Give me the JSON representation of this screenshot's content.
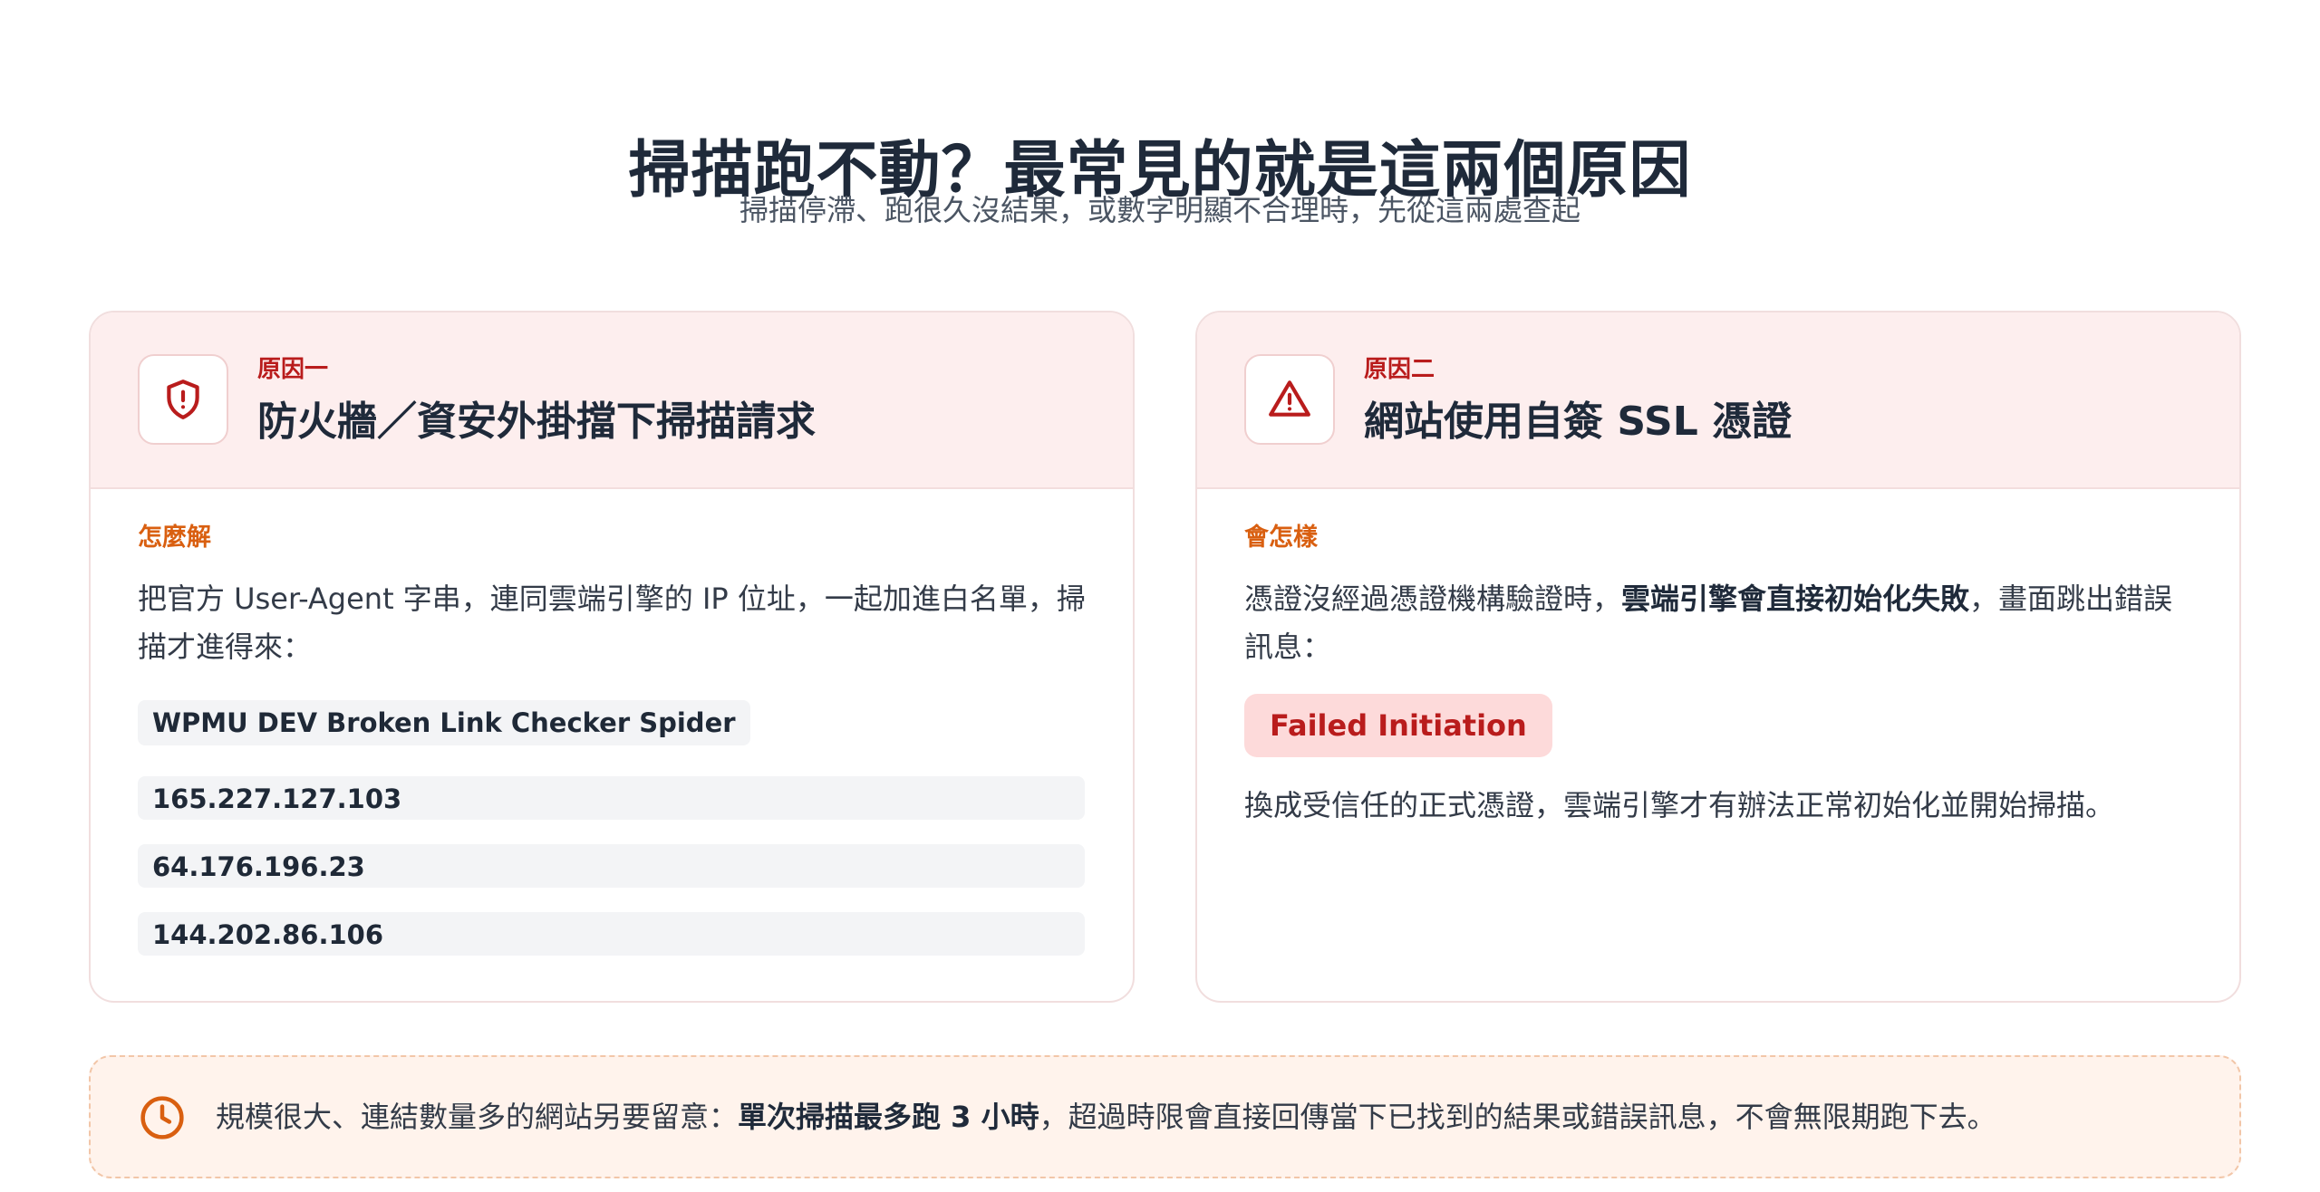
{
  "header": {
    "title": "掃描跑不動？最常見的就是這兩個原因",
    "subtitle": "掃描停滯、跑很久沒結果，或數字明顯不合理時，先從這兩處查起"
  },
  "colors": {
    "accent_red": "#b91c1c",
    "accent_orange": "#d95f10",
    "card_header_bg": "#fdeeee",
    "notice_bg": "#fff3ec"
  },
  "cards": [
    {
      "icon": "shield-alert-icon",
      "tag": "原因一",
      "title": "防火牆／資安外掛擋下掃描請求",
      "section_label": "怎麼解",
      "body": "把官方 User-Agent 字串，連同雲端引擎的 IP 位址，一起加進白名單，掃描才進得來：",
      "user_agent": "WPMU DEV Broken Link Checker Spider",
      "ips": [
        "165.227.127.103",
        "64.176.196.23",
        "144.202.86.106"
      ]
    },
    {
      "icon": "warning-triangle-icon",
      "tag": "原因二",
      "title": "網站使用自簽 SSL 憑證",
      "section_label": "會怎樣",
      "body_before": "憑證沒經過憑證機構驗證時，",
      "body_bold": "雲端引擎會直接初始化失敗",
      "body_after": "，畫面跳出錯誤訊息：",
      "badge": "Failed Initiation",
      "after_text": "換成受信任的正式憑證，雲端引擎才有辦法正常初始化並開始掃描。"
    }
  ],
  "notice": {
    "icon": "clock-icon",
    "text_before": "規模很大、連結數量多的網站另要留意：",
    "text_bold": "單次掃描最多跑 3 小時",
    "text_after": "，超過時限會直接回傳當下已找到的結果或錯誤訊息，不會無限期跑下去。"
  }
}
